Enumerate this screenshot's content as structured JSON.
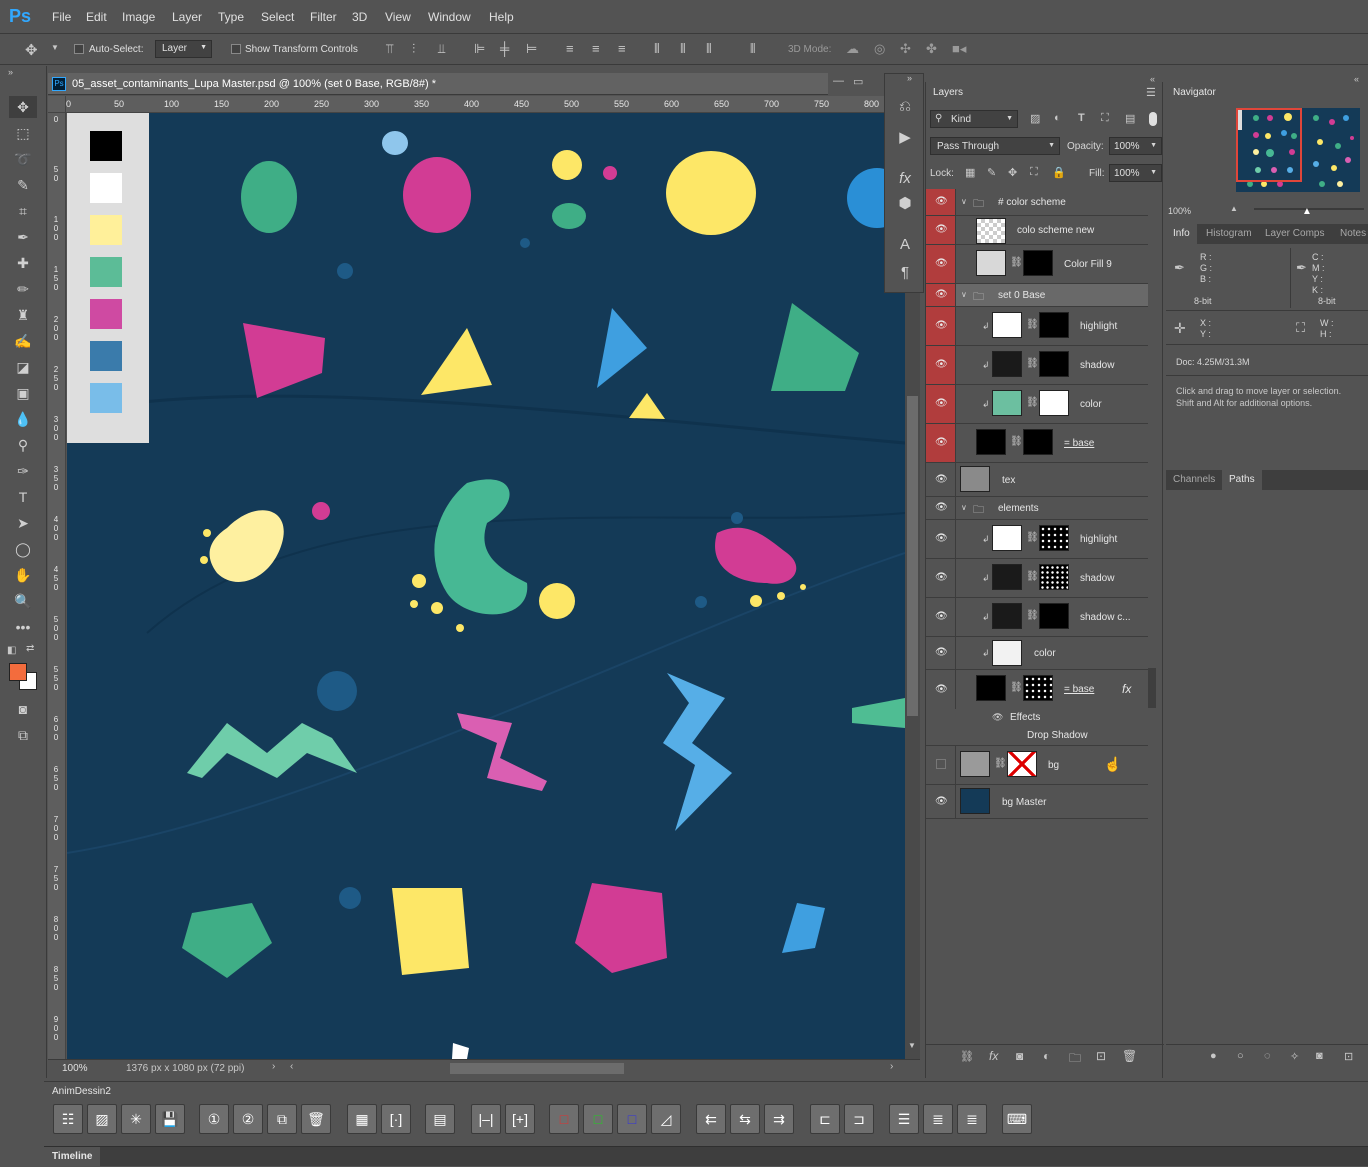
{
  "app": {
    "logo": "Ps"
  },
  "menu": [
    "File",
    "Edit",
    "Image",
    "Layer",
    "Type",
    "Select",
    "Filter",
    "3D",
    "View",
    "Window",
    "Help"
  ],
  "options": {
    "auto_select": "Auto-Select:",
    "auto_select_target": "Layer",
    "show_transform": "Show Transform Controls",
    "mode3d": "3D Mode:"
  },
  "document": {
    "tab_title": "05_asset_contaminants_Lupa Master.psd @ 100% (set 0 Base, RGB/8#) *",
    "zoom": "100%",
    "size": "1376 px x 1080 px (72 ppi)"
  },
  "ruler_top": [
    "0",
    "50",
    "100",
    "150",
    "200",
    "250",
    "300",
    "350",
    "400",
    "450",
    "500",
    "550",
    "600",
    "650",
    "700",
    "750",
    "800"
  ],
  "ruler_left": [
    "0",
    "50",
    "100",
    "150",
    "200",
    "250",
    "300",
    "350",
    "400",
    "450",
    "500",
    "550",
    "600",
    "650",
    "700",
    "750",
    "800",
    "850",
    "900"
  ],
  "swatches": [
    "#000000",
    "#ffffff",
    "#fff09a",
    "#5cbc97",
    "#cf4aa2",
    "#3a7bab",
    "#79bde9"
  ],
  "layers_panel": {
    "tab": "Layers",
    "filter": "Kind",
    "blend": "Pass Through",
    "opacity_label": "Opacity:",
    "opacity": "100%",
    "lock_label": "Lock:",
    "fill_label": "Fill:",
    "fill": "100%",
    "rows": [
      {
        "name": "# color scheme"
      },
      {
        "name": "colo scheme new"
      },
      {
        "name": "Color Fill 9"
      },
      {
        "name": "set 0 Base"
      },
      {
        "name": "highlight"
      },
      {
        "name": "shadow"
      },
      {
        "name": "color"
      },
      {
        "name": "= base"
      },
      {
        "name": "tex"
      },
      {
        "name": "elements"
      },
      {
        "name": "highlight"
      },
      {
        "name": "shadow"
      },
      {
        "name": "shadow c..."
      },
      {
        "name": "color"
      },
      {
        "name": "= base"
      },
      {
        "name": "Effects"
      },
      {
        "name": "Drop Shadow"
      },
      {
        "name": "bg"
      },
      {
        "name": "bg Master"
      }
    ]
  },
  "navigator": {
    "tab": "Navigator",
    "zoom": "100%"
  },
  "info": {
    "tabs": [
      "Info",
      "Histogram",
      "Layer Comps",
      "Notes"
    ],
    "rgb": [
      "R :",
      "G :",
      "B :"
    ],
    "cmyk": [
      "C :",
      "M :",
      "Y :",
      "K :"
    ],
    "bits_left": "8-bit",
    "bits_right": "8-bit",
    "xy": [
      "X :",
      "Y :"
    ],
    "wh": [
      "W :",
      "H :"
    ],
    "doc": "Doc: 4.25M/31.3M",
    "hint1": "Click and drag to move layer or selection.",
    "hint2": "Shift and Alt for additional options."
  },
  "paths": {
    "tabs": [
      "Channels",
      "Paths"
    ]
  },
  "timeline": {
    "panel_title": "AnimDessin2",
    "bottom_tab": "Timeline"
  }
}
